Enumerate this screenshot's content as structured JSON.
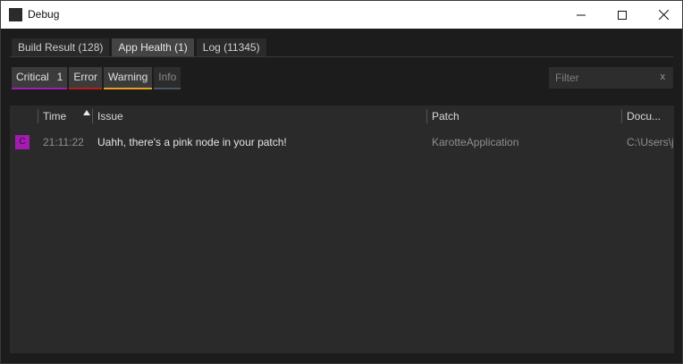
{
  "window": {
    "title": "Debug"
  },
  "tabs": [
    {
      "label": "Build Result (128)"
    },
    {
      "label": "App Health (1)"
    },
    {
      "label": "Log (11345)"
    }
  ],
  "filters": {
    "critical": {
      "label": "Critical",
      "count": "1",
      "color": "#a21caf"
    },
    "error": {
      "label": "Error",
      "color": "#b91c1c"
    },
    "warning": {
      "label": "Warning",
      "color": "#e8a020"
    },
    "info": {
      "label": "Info",
      "color": "#4b5563"
    }
  },
  "search": {
    "placeholder": "Filter",
    "clear": "x"
  },
  "table": {
    "columns": {
      "time": "Time",
      "issue": "Issue",
      "patch": "Patch",
      "document": "Docu..."
    },
    "sort": {
      "column": "time",
      "direction": "ascending"
    },
    "rows": [
      {
        "severity_icon": "C",
        "time": "21:11:22",
        "issue": "Uahh, there's a pink node in your patch!",
        "patch": "KarotteApplication",
        "document": "C:\\Users\\j"
      }
    ]
  }
}
